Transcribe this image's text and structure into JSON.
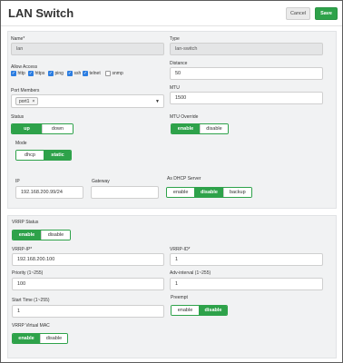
{
  "header": {
    "title": "LAN Switch",
    "cancel_label": "Cancel",
    "save_label": "Save"
  },
  "general": {
    "name_label": "Name*",
    "name_value": "lan",
    "type_label": "Type",
    "type_value": "lan-switch",
    "allow_access_label": "Allow Access",
    "access": [
      {
        "label": "http",
        "checked": true
      },
      {
        "label": "https",
        "checked": true
      },
      {
        "label": "ping",
        "checked": true
      },
      {
        "label": "ssh",
        "checked": true
      },
      {
        "label": "telnet",
        "checked": true
      },
      {
        "label": "snmp",
        "checked": false
      }
    ],
    "distance_label": "Distance",
    "distance_value": "50",
    "port_members_label": "Port Members",
    "port_tag": "port1",
    "mtu_label": "MTU",
    "mtu_value": "1500",
    "status_label": "Status",
    "status_options": [
      "up",
      "down"
    ],
    "status_selected": "up",
    "mtu_override_label": "MTU Override",
    "mtu_override_options": [
      "enable",
      "disable"
    ],
    "mtu_override_selected": "enable",
    "mode_label": "Mode",
    "mode_options": [
      "dhcp",
      "static"
    ],
    "mode_selected": "static",
    "ip_label": "IP",
    "ip_value": "192.168.200.99/24",
    "gateway_label": "Gateway",
    "gateway_value": "",
    "dhcp_server_label": "As DHCP Server",
    "dhcp_server_options": [
      "enable",
      "disable",
      "backup"
    ],
    "dhcp_server_selected": "disable"
  },
  "vrrp": {
    "status_label": "VRRP Status",
    "status_options": [
      "enable",
      "disable"
    ],
    "status_selected": "enable",
    "ip_label": "VRRP-IP*",
    "ip_value": "192.168.200.100",
    "id_label": "VRRP-ID*",
    "id_value": "1",
    "priority_label": "Priority (1~255)",
    "priority_value": "100",
    "adv_label": "Adv-interval (1~255)",
    "adv_value": "1",
    "start_time_label": "Start Time (1~255)",
    "start_time_value": "1",
    "preempt_label": "Preempt",
    "preempt_options": [
      "enable",
      "disable"
    ],
    "preempt_selected": "disable",
    "vmac_label": "VRRP Virtual MAC",
    "vmac_options": [
      "enable",
      "disable"
    ],
    "vmac_selected": "enable"
  },
  "colors": {
    "accent": "#2ea24a",
    "checkbox": "#2b7de1",
    "panel": "#f1f2f3"
  },
  "icons": {
    "remove_tag": "close-icon",
    "dropdown": "chevron-down-icon"
  }
}
